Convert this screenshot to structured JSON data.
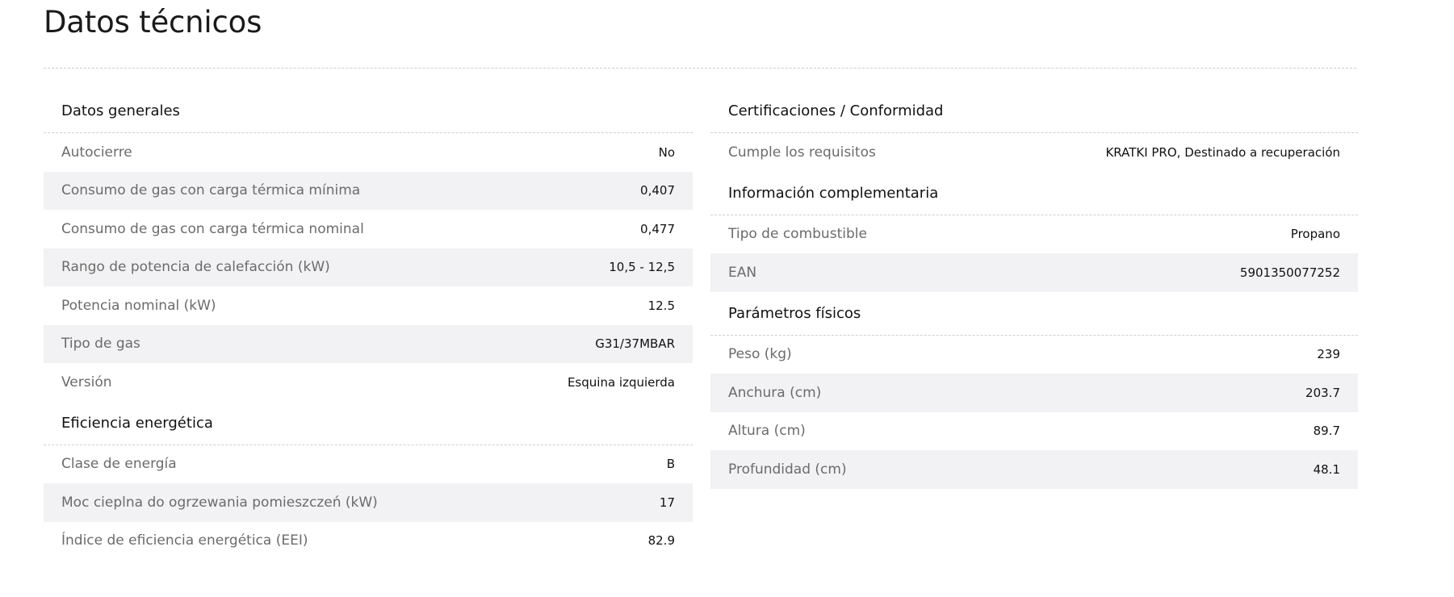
{
  "page_title": "Datos técnicos",
  "left_sections": [
    {
      "title": "Datos generales",
      "rows": [
        {
          "label": "Autocierre",
          "value": "No"
        },
        {
          "label": "Consumo de gas con carga térmica mínima",
          "value": "0,407"
        },
        {
          "label": "Consumo de gas con carga térmica nominal",
          "value": "0,477"
        },
        {
          "label": "Rango de potencia de calefacción (kW)",
          "value": "10,5 - 12,5"
        },
        {
          "label": "Potencia nominal (kW)",
          "value": "12.5"
        },
        {
          "label": "Tipo de gas",
          "value": "G31/37MBAR"
        },
        {
          "label": "Versión",
          "value": "Esquina izquierda"
        }
      ]
    },
    {
      "title": "Eficiencia energética",
      "rows": [
        {
          "label": "Clase de energía",
          "value": "B"
        },
        {
          "label": "Moc cieplna do ogrzewania pomieszczeń (kW)",
          "value": "17"
        },
        {
          "label": "Índice de eficiencia energética (EEI)",
          "value": "82.9"
        }
      ]
    }
  ],
  "right_sections": [
    {
      "title": "Certificaciones / Conformidad",
      "rows": [
        {
          "label": "Cumple los requisitos",
          "value": "KRATKI PRO, Destinado a recuperación"
        }
      ]
    },
    {
      "title": "Información complementaria",
      "rows": [
        {
          "label": "Tipo de combustible",
          "value": "Propano"
        },
        {
          "label": "EAN",
          "value": "5901350077252"
        }
      ]
    },
    {
      "title": "Parámetros físicos",
      "rows": [
        {
          "label": "Peso (kg)",
          "value": "239"
        },
        {
          "label": "Anchura (cm)",
          "value": "203.7"
        },
        {
          "label": "Altura (cm)",
          "value": "89.7"
        },
        {
          "label": "Profundidad (cm)",
          "value": "48.1"
        }
      ]
    }
  ]
}
